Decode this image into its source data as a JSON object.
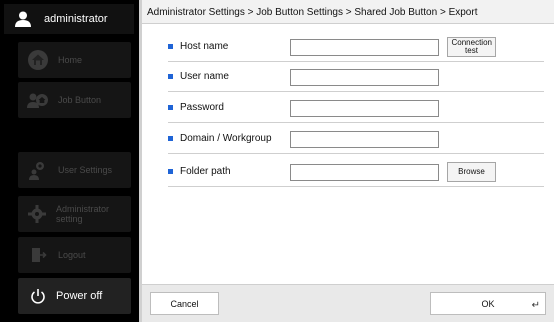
{
  "sidebar": {
    "user_label": "administrator",
    "items": [
      {
        "label": "Home",
        "icon": "home-icon"
      },
      {
        "label": "Job Button",
        "icon": "job-button-icon"
      },
      {
        "label": "User Settings",
        "icon": "user-settings-icon"
      },
      {
        "label": "Administrator setting",
        "icon": "admin-gear-icon"
      },
      {
        "label": "Logout",
        "icon": "logout-icon"
      }
    ],
    "power_label": "Power off"
  },
  "breadcrumb": "Administrator Settings > Job Button Settings > Shared Job Button > Export",
  "form": {
    "rows": [
      {
        "label": "Host name",
        "value": "",
        "button": "Connection test"
      },
      {
        "label": "User name",
        "value": ""
      },
      {
        "label": "Password",
        "value": ""
      },
      {
        "label": "Domain / Workgroup",
        "value": ""
      },
      {
        "label": "Folder path",
        "value": "",
        "button": "Browse"
      }
    ]
  },
  "footer": {
    "cancel_label": "Cancel",
    "ok_label": "OK"
  },
  "colors": {
    "accent": "#1f64d6",
    "sidebar_bg": "#000000"
  }
}
